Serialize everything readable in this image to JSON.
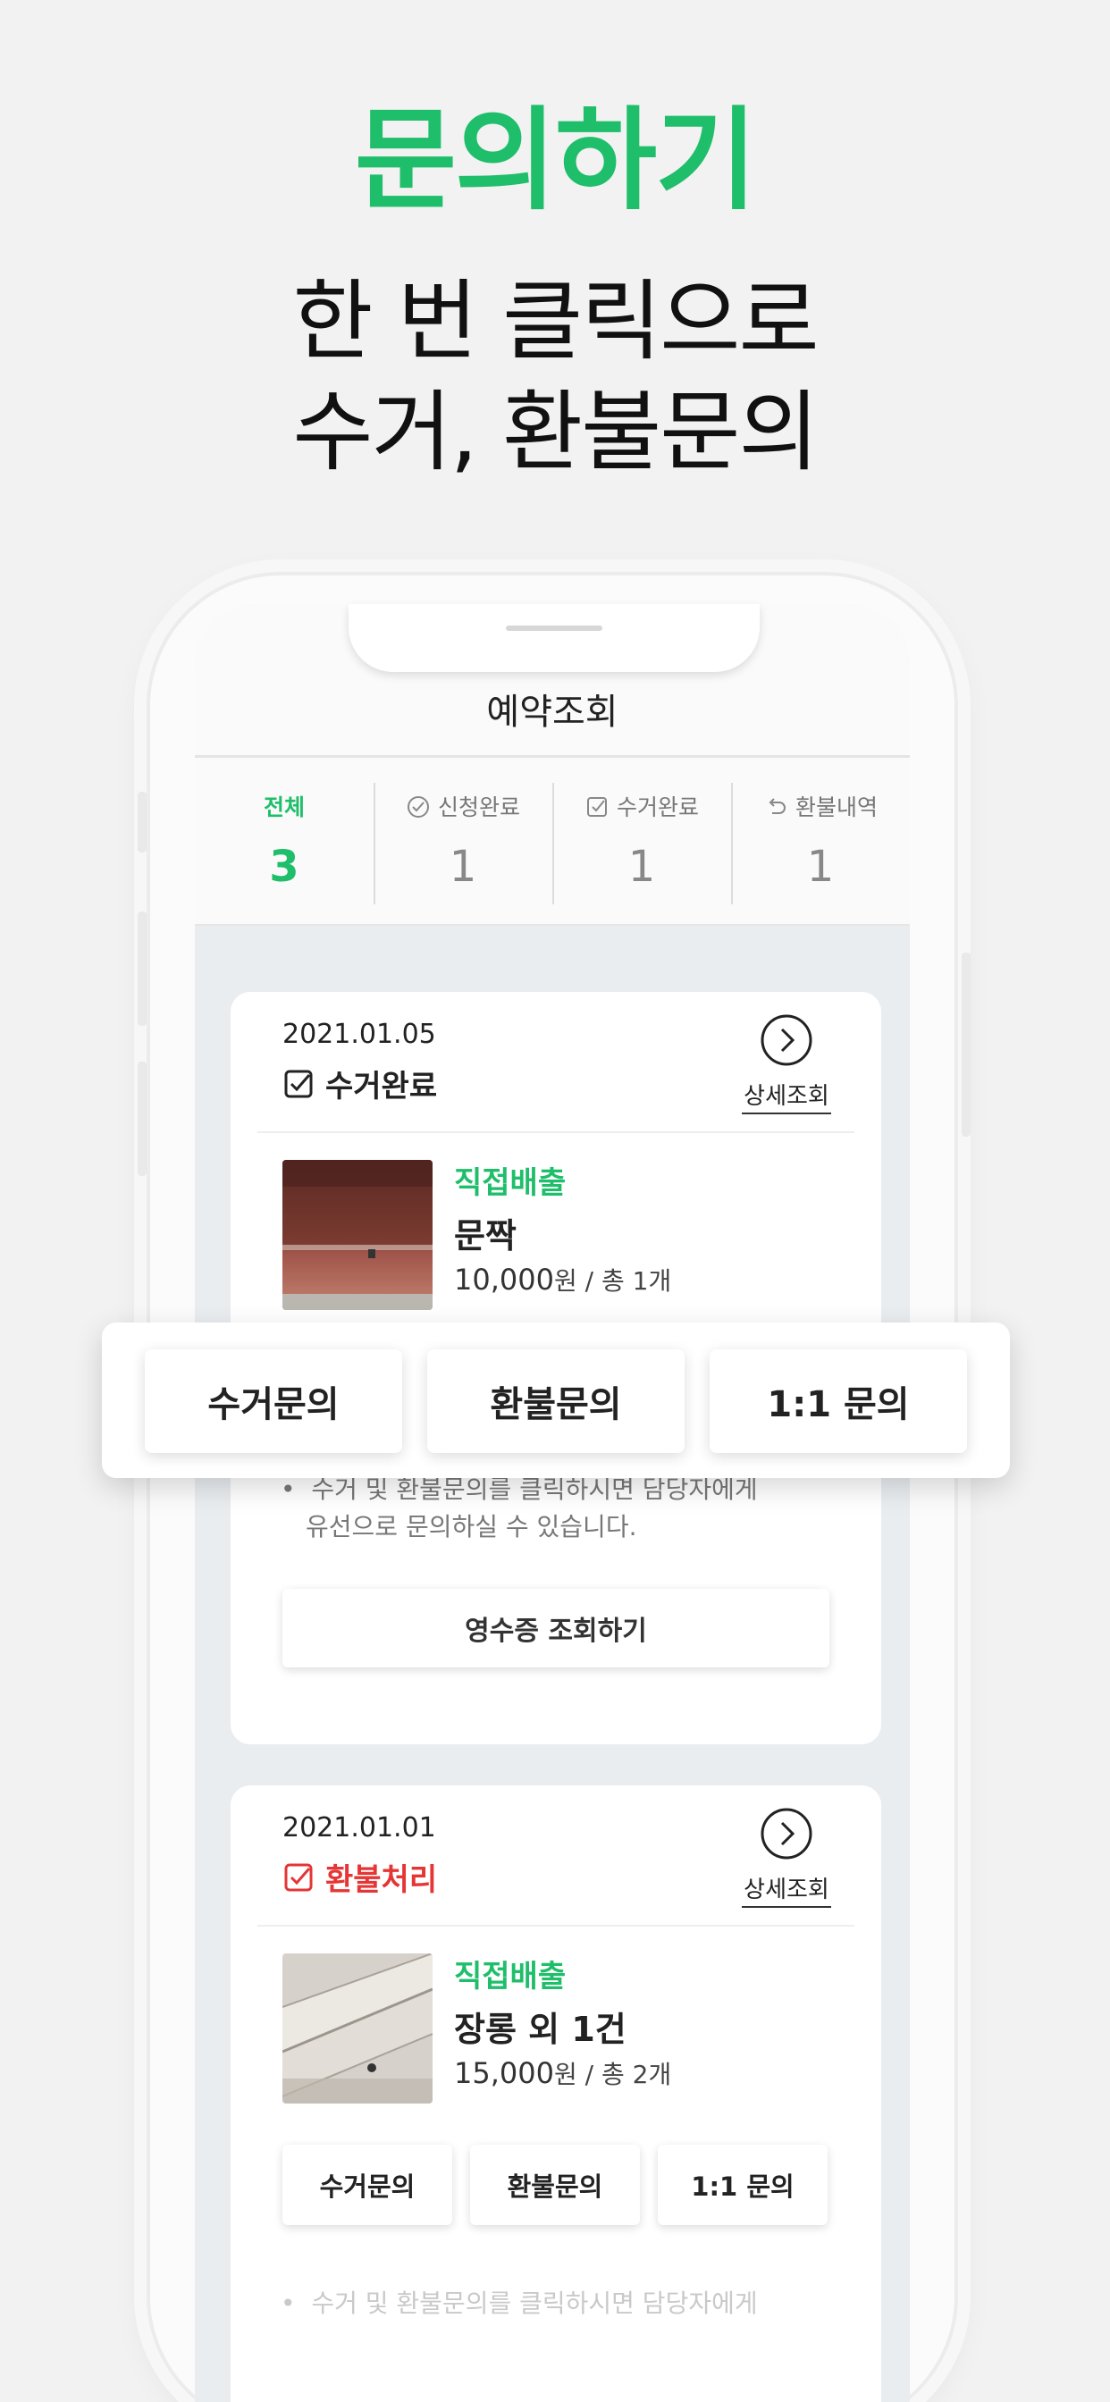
{
  "hero": {
    "title": "문의하기",
    "subtitle_line1": "한 번 클릭으로",
    "subtitle_line2": "수거, 환불문의"
  },
  "app": {
    "title": "예약조회"
  },
  "tabs": [
    {
      "label": "전체",
      "count": "3",
      "icon": "none",
      "active": true
    },
    {
      "label": "신청완료",
      "count": "1",
      "icon": "check-circle-icon",
      "active": false
    },
    {
      "label": "수거완료",
      "count": "1",
      "icon": "check-box-icon",
      "active": false
    },
    {
      "label": "환불내역",
      "count": "1",
      "icon": "undo-arrow-icon",
      "active": false
    }
  ],
  "orders": [
    {
      "date": "2021.01.05",
      "status": "수거완료",
      "status_color": "#222222",
      "detail_label": "상세조회",
      "type": "직접배출",
      "name": "문짝",
      "price": "10,000",
      "price_unit": "원 / 총 1개",
      "buttons": [
        "수거문의",
        "환불문의",
        "1:1 문의"
      ],
      "note_line1": "수거 및 환불문의를 클릭하시면 담당자에게",
      "note_line2": "유선으로 문의하실 수 있습니다.",
      "receipt_label": "영수증 조회하기"
    },
    {
      "date": "2021.01.01",
      "status": "환불처리",
      "status_color": "#e53535",
      "detail_label": "상세조회",
      "type": "직접배출",
      "name": "장롱 외 1건",
      "price": "15,000",
      "price_unit": "원 / 총 2개",
      "buttons": [
        "수거문의",
        "환불문의",
        "1:1 문의"
      ],
      "note_line1": "수거 및 환불문의를 클릭하시면 담당자에게"
    }
  ],
  "overlay": {
    "buttons": [
      "수거문의",
      "환불문의",
      "1:1 문의"
    ]
  },
  "colors": {
    "accent": "#1fbe6a",
    "refund": "#e53535",
    "background": "#f2f2f2"
  }
}
